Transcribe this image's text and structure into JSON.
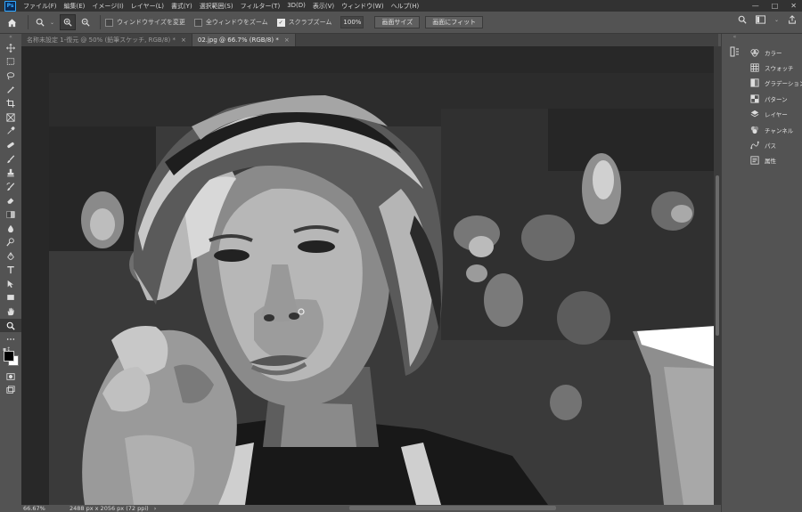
{
  "app": {
    "logo_text": "Ps"
  },
  "menu": [
    "ファイル(F)",
    "編集(E)",
    "イメージ(I)",
    "レイヤー(L)",
    "書式(Y)",
    "選択範囲(S)",
    "フィルター(T)",
    "3D(D)",
    "表示(V)",
    "ウィンドウ(W)",
    "ヘルプ(H)"
  ],
  "window_controls": {
    "minimize": "—",
    "maximize": "□",
    "close": "✕"
  },
  "options_bar": {
    "resize_windows_label": "ウィンドウサイズを変更",
    "resize_windows_checked": false,
    "zoom_all_windows_label": "全ウィンドウをズーム",
    "zoom_all_windows_checked": false,
    "scrubby_zoom_label": "スクラブズーム",
    "scrubby_zoom_checked": true,
    "zoom_value": "100%",
    "fit_screen_label": "画面サイズ",
    "fill_screen_label": "画面にフィット"
  },
  "tabs": [
    {
      "label": "名称未設定 1-復元 @ 50% (鉛筆スケッチ, RGB/8) *",
      "active": false,
      "close": "×"
    },
    {
      "label": "02.jpg @ 66.7% (RGB/8) *",
      "active": true,
      "close": "×"
    }
  ],
  "status": {
    "zoom": "66.67%",
    "doc_info": "2488 px x 2056 px (72 ppi)",
    "arrow": "›"
  },
  "toolbar_grip": "«",
  "swatch_mini": "▪↕",
  "tools": [
    {
      "name": "move-tool-icon",
      "glyph": "move"
    },
    {
      "name": "marquee-tool-icon",
      "glyph": "marquee"
    },
    {
      "name": "lasso-tool-icon",
      "glyph": "lasso"
    },
    {
      "name": "quick-select-tool-icon",
      "glyph": "wand"
    },
    {
      "name": "crop-tool-icon",
      "glyph": "crop"
    },
    {
      "name": "frame-tool-icon",
      "glyph": "frame"
    },
    {
      "name": "eyedropper-tool-icon",
      "glyph": "eyedropper"
    },
    {
      "name": "healing-brush-tool-icon",
      "glyph": "bandage"
    },
    {
      "name": "brush-tool-icon",
      "glyph": "brush"
    },
    {
      "name": "clone-stamp-tool-icon",
      "glyph": "stamp"
    },
    {
      "name": "history-brush-tool-icon",
      "glyph": "hbrush"
    },
    {
      "name": "eraser-tool-icon",
      "glyph": "eraser"
    },
    {
      "name": "gradient-tool-icon",
      "glyph": "gradient"
    },
    {
      "name": "blur-tool-icon",
      "glyph": "drop"
    },
    {
      "name": "dodge-tool-icon",
      "glyph": "dodge"
    },
    {
      "name": "pen-tool-icon",
      "glyph": "pen"
    },
    {
      "name": "type-tool-icon",
      "glyph": "T"
    },
    {
      "name": "path-selection-tool-icon",
      "glyph": "arrow"
    },
    {
      "name": "rectangle-tool-icon",
      "glyph": "rect"
    },
    {
      "name": "hand-tool-icon",
      "glyph": "hand"
    },
    {
      "name": "zoom-tool-icon",
      "glyph": "zoom",
      "active": true
    },
    {
      "name": "edit-toolbar-icon",
      "glyph": "dots"
    }
  ],
  "panels": [
    {
      "label": "カラー",
      "icon": "color-panel-icon"
    },
    {
      "label": "スウォッチ",
      "icon": "swatches-panel-icon"
    },
    {
      "label": "グラデーション",
      "icon": "gradients-panel-icon"
    },
    {
      "label": "パターン",
      "icon": "patterns-panel-icon"
    },
    {
      "label": "レイヤー",
      "icon": "layers-panel-icon"
    },
    {
      "label": "チャンネル",
      "icon": "channels-panel-icon"
    },
    {
      "label": "パス",
      "icon": "paths-panel-icon"
    },
    {
      "label": "属性",
      "icon": "properties-panel-icon"
    }
  ],
  "colors": {
    "chrome": "#535353",
    "menubar": "#323232",
    "canvas_bg": "#282828",
    "logo_accent": "#31a8ff"
  }
}
